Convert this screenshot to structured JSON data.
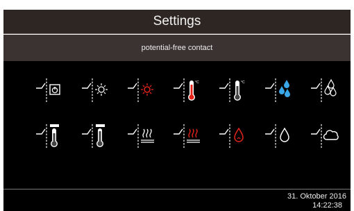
{
  "header": {
    "title": "Settings"
  },
  "subheader": {
    "title": "potential-free contact"
  },
  "icons": {
    "row1": [
      "switch-on-off-icon",
      "sun-icon",
      "sun-red-icon",
      "thermometer-red-icon",
      "thermometer-white-icon",
      "water-drops-blue-icon",
      "water-drops-icon"
    ],
    "row2": [
      "thermometer-outdoor-icon",
      "thermometer-outdoor-2-icon",
      "heating-icon",
      "heating-red-icon",
      "drop-red-icon",
      "drop-white-icon",
      "cloud-icon"
    ]
  },
  "colors": {
    "background": "#000000",
    "title_bar": "#2e2623",
    "accent_red": "#e2231a",
    "accent_blue": "#3aa8e8"
  },
  "footer": {
    "date": "31. Oktober 2016",
    "time": "14:22:38"
  }
}
